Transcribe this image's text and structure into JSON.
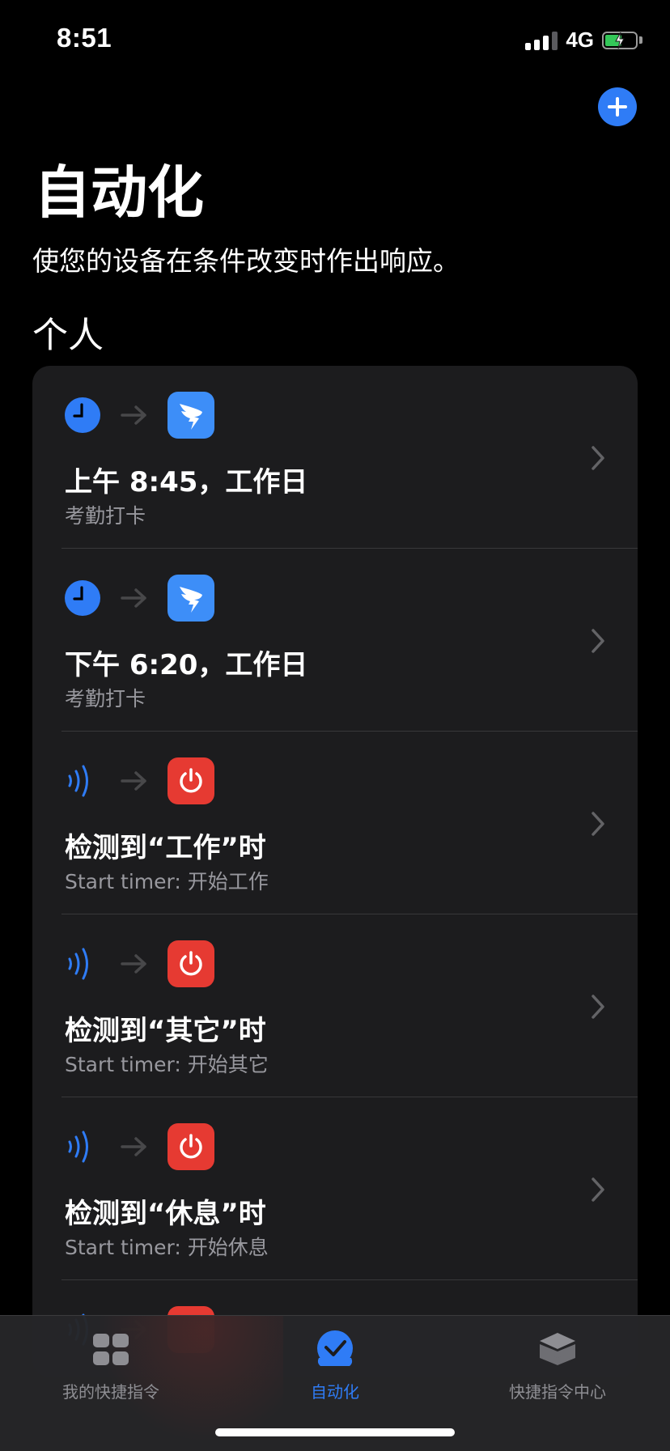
{
  "status_bar": {
    "time": "8:51",
    "network": "4G",
    "battery_color": "#34c759"
  },
  "header": {
    "title": "自动化",
    "subtitle": "使您的设备在条件改变时作出响应。",
    "add_icon": "plus-icon"
  },
  "section": {
    "title": "个人"
  },
  "automations": [
    {
      "trigger_icon": "clock-icon",
      "action_icon": "dingtalk-icon",
      "title": "上午 8:45，工作日",
      "subtitle": "考勤打卡"
    },
    {
      "trigger_icon": "clock-icon",
      "action_icon": "dingtalk-icon",
      "title": "下午 6:20，工作日",
      "subtitle": "考勤打卡"
    },
    {
      "trigger_icon": "nfc-icon",
      "action_icon": "power-icon",
      "title": "检测到“工作”时",
      "subtitle": "Start timer: 开始工作"
    },
    {
      "trigger_icon": "nfc-icon",
      "action_icon": "power-icon",
      "title": "检测到“其它”时",
      "subtitle": "Start timer: 开始其它"
    },
    {
      "trigger_icon": "nfc-icon",
      "action_icon": "power-icon",
      "title": "检测到“休息”时",
      "subtitle": "Start timer: 开始休息"
    }
  ],
  "tab_bar": {
    "tabs": [
      {
        "label": "我的快捷指令",
        "icon": "grid-icon",
        "active": false
      },
      {
        "label": "自动化",
        "icon": "checkmark-circle-icon",
        "active": true
      },
      {
        "label": "快捷指令中心",
        "icon": "layers-icon",
        "active": false
      }
    ],
    "accent_color": "#2f7cf6"
  }
}
